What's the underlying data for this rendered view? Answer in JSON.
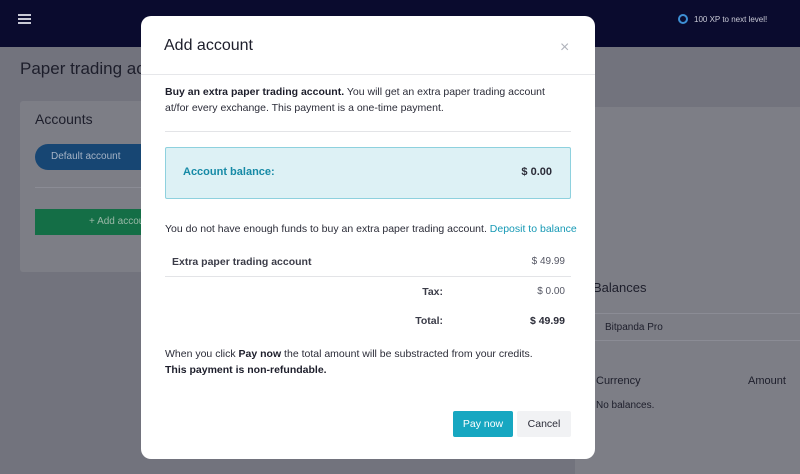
{
  "app": {
    "xp_text": "100 XP to next level!",
    "page_title": "Paper trading acc",
    "accounts_card": {
      "title": "Accounts",
      "default_account_label": "Default account",
      "add_account_label": "Add accou"
    },
    "balances_card": {
      "title": "Balances",
      "exchange": "Bitpanda Pro",
      "col_currency": "Currency",
      "col_amount": "Amount",
      "empty": "No balances."
    }
  },
  "modal": {
    "title": "Add account",
    "close_glyph": "×",
    "intro_bold": "Buy an extra paper trading account.",
    "intro_rest": " You will get an extra paper trading account at/for every exchange. This payment is a one-time payment.",
    "balance_label": "Account balance:",
    "balance_value": "$ 0.00",
    "funds_message": "You do not have enough funds to buy an extra paper trading account.",
    "deposit_link": "Deposit to balance",
    "item_name": "Extra paper trading account",
    "item_price": "$ 49.99",
    "tax_label": "Tax:",
    "tax_value": "$ 0.00",
    "total_label": "Total:",
    "total_value": "$ 49.99",
    "note_prefix": "When you click ",
    "note_bold": "Pay now",
    "note_suffix": " the total amount will be substracted from your credits.",
    "note_refund": "This payment is non-refundable.",
    "pay_label": "Pay now",
    "cancel_label": "Cancel"
  }
}
